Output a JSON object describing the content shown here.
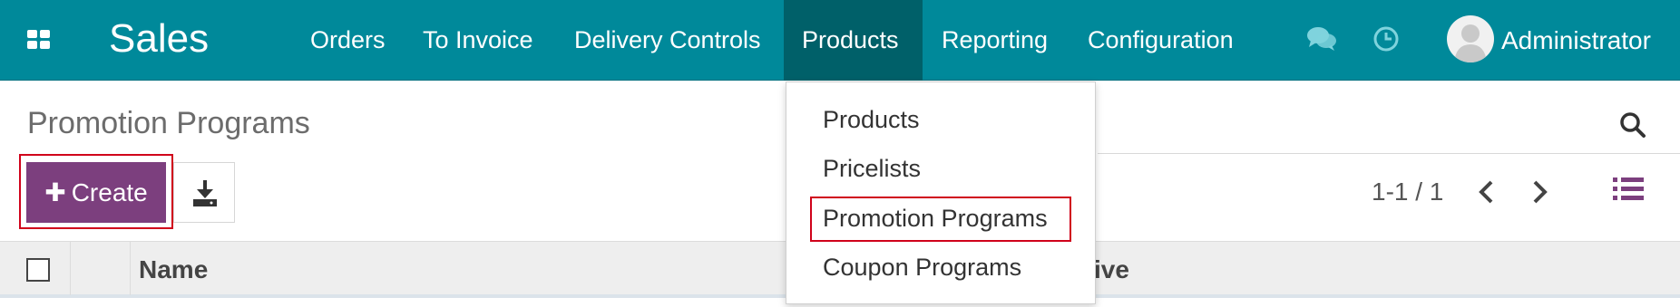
{
  "navbar": {
    "brand": "Sales",
    "menu": [
      {
        "label": "Orders"
      },
      {
        "label": "To Invoice"
      },
      {
        "label": "Delivery Controls"
      },
      {
        "label": "Products"
      },
      {
        "label": "Reporting"
      },
      {
        "label": "Configuration"
      }
    ],
    "active_menu": "Products",
    "icons": [
      "apps-grid-icon",
      "chat-bubbles-icon",
      "clock-activity-icon"
    ],
    "user": {
      "name": "Administrator",
      "avatar_icon": "user-avatar-icon"
    },
    "colors": {
      "bar": "#00899a",
      "active": "#006069"
    }
  },
  "control_panel": {
    "title": "Promotion Programs",
    "create_label": "Create",
    "create_icon": "plus-icon",
    "download_icon": "download-icon",
    "search_icon": "search-icon",
    "pager": "1-1 / 1",
    "pager_icons": [
      "chevron-left-icon",
      "chevron-right-icon"
    ],
    "view_icon": "list-view-icon",
    "colors": {
      "primary": "#7c3f7e",
      "highlight": "#d0021b"
    }
  },
  "table": {
    "columns": [
      "Name",
      "ive"
    ]
  },
  "dropdown": {
    "items": [
      {
        "label": "Products"
      },
      {
        "label": "Pricelists"
      },
      {
        "label": "Promotion Programs"
      },
      {
        "label": "Coupon Programs"
      }
    ],
    "highlighted": "Promotion Programs"
  }
}
